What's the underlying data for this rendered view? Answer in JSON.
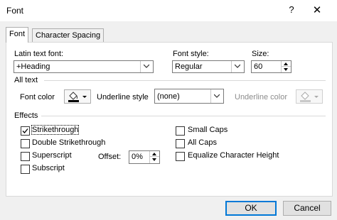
{
  "window": {
    "title": "Font",
    "help_label": "?",
    "close_label": "✕"
  },
  "tabs": [
    {
      "label": "Font",
      "active": true
    },
    {
      "label": "Character Spacing",
      "active": false
    }
  ],
  "latin_font": {
    "label": "Latin text font:",
    "value": "+Heading"
  },
  "font_style": {
    "label": "Font style:",
    "value": "Regular"
  },
  "size": {
    "label": "Size:",
    "value": "60"
  },
  "all_text": {
    "group_label": "All text",
    "font_color_label": "Font color",
    "underline_style_label": "Underline style",
    "underline_style_value": "(none)",
    "underline_color_label": "Underline color"
  },
  "effects": {
    "group_label": "Effects",
    "strikethrough": {
      "label": "Strikethrough",
      "checked": true
    },
    "double_strikethrough": {
      "label": "Double Strikethrough",
      "checked": false
    },
    "superscript": {
      "label": "Superscript",
      "checked": false
    },
    "subscript": {
      "label": "Subscript",
      "checked": false
    },
    "offset_label": "Offset:",
    "offset_value": "0%",
    "small_caps": {
      "label": "Small Caps",
      "checked": false
    },
    "all_caps": {
      "label": "All Caps",
      "checked": false
    },
    "equalize": {
      "label": "Equalize Character Height",
      "checked": false
    }
  },
  "buttons": {
    "ok": "OK",
    "cancel": "Cancel"
  },
  "colors": {
    "accent": "#0078d7",
    "font_color_swatch": "#000000"
  }
}
